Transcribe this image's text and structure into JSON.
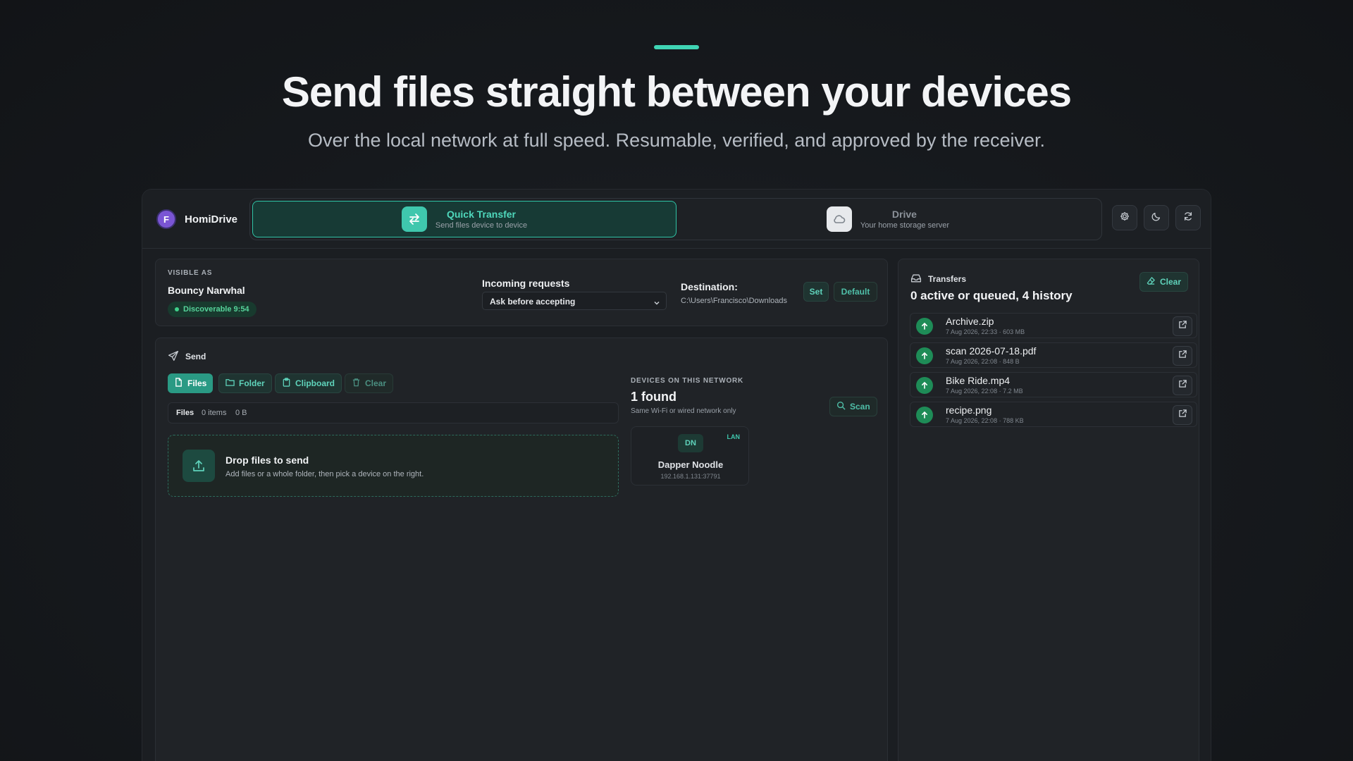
{
  "hero": {
    "title": "Send files straight between your devices",
    "subtitle": "Over the local network at full speed. Resumable, verified, and approved by the receiver."
  },
  "app": {
    "avatar_letter": "F",
    "brand": "HomiDrive"
  },
  "modes": [
    {
      "title": "Quick Transfer",
      "desc": "Send files device to device"
    },
    {
      "title": "Drive",
      "desc": "Your home storage server"
    }
  ],
  "toolbar": {
    "settings_icon": "gear-icon",
    "theme_icon": "moon-icon",
    "refresh_icon": "refresh-icon"
  },
  "identity": {
    "visible_as_label": "VISIBLE AS",
    "device_name": "Bouncy Narwhal",
    "discoverable": "Discoverable 9:54"
  },
  "incoming": {
    "label": "Incoming requests",
    "selected": "Ask before accepting"
  },
  "destination": {
    "label": "Destination:",
    "path": "C:\\Users\\Francisco\\Downloads",
    "set": "Set",
    "default": "Default"
  },
  "send": {
    "title": "Send",
    "buttons": {
      "files": "Files",
      "folder": "Folder",
      "clipboard": "Clipboard",
      "clear": "Clear"
    },
    "summary": {
      "label": "Files",
      "items": "0 items",
      "size": "0 B"
    },
    "drop": {
      "title": "Drop files to send",
      "desc": "Add files or a whole folder, then pick a device on the right."
    }
  },
  "devices": {
    "label": "DEVICES ON THIS NETWORK",
    "count": "1 found",
    "note": "Same Wi-Fi or wired network only",
    "scan": "Scan",
    "list": [
      {
        "initials": "DN",
        "badge": "LAN",
        "name": "Dapper Noodle",
        "ip": "192.168.1.131:37791"
      }
    ]
  },
  "transfers": {
    "title": "Transfers",
    "clear": "Clear",
    "summary": "0 active or queued, 4 history",
    "items": [
      {
        "name": "Archive.zip",
        "meta": "7 Aug 2026, 22:33 · 603 MB"
      },
      {
        "name": "scan 2026-07-18.pdf",
        "meta": "7 Aug 2026, 22:08 · 848 B"
      },
      {
        "name": "Bike Ride.mp4",
        "meta": "7 Aug 2026, 22:08 · 7.2 MB"
      },
      {
        "name": "recipe.png",
        "meta": "7 Aug 2026, 22:08 · 788 KB"
      }
    ]
  },
  "colors": {
    "accent": "#3fd4b4",
    "success": "#1e8c57",
    "background": "#16191d"
  }
}
